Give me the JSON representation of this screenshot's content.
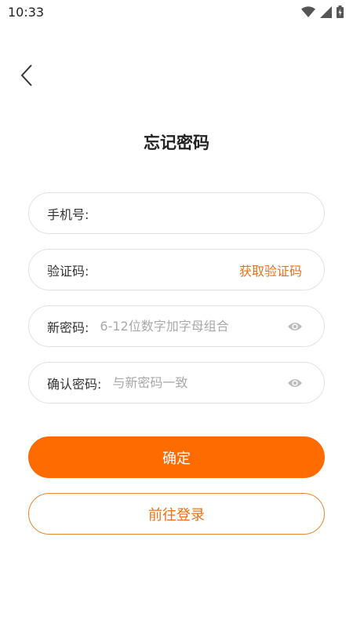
{
  "status_bar": {
    "time": "10:33"
  },
  "page": {
    "title": "忘记密码"
  },
  "form": {
    "phone": {
      "label": "手机号:",
      "value": "",
      "placeholder": ""
    },
    "code": {
      "label": "验证码:",
      "value": "",
      "placeholder": "",
      "action_label": "获取验证码"
    },
    "new_password": {
      "label": "新密码:",
      "value": "",
      "placeholder": "6-12位数字加字母组合"
    },
    "confirm_password": {
      "label": "确认密码:",
      "value": "",
      "placeholder": "与新密码一致"
    }
  },
  "buttons": {
    "confirm_label": "确定",
    "login_label": "前往登录"
  },
  "colors": {
    "accent": "#fe6b00",
    "accent_text": "#e0731e",
    "border": "#e2e2e2",
    "placeholder": "#a8a8a8"
  },
  "icons": {
    "back": "chevron-left-icon",
    "visibility": "eye-icon",
    "wifi": "wifi-icon",
    "signal": "signal-icon",
    "battery": "battery-icon"
  }
}
